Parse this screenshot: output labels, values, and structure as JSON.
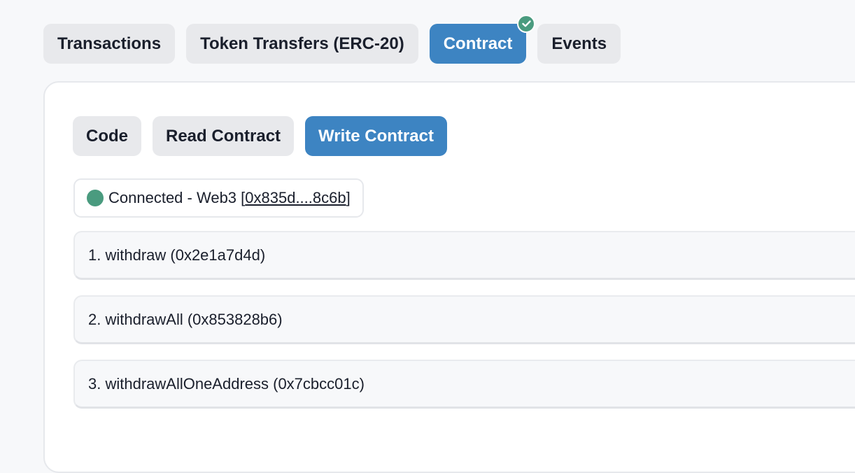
{
  "tabs": [
    {
      "label": "Transactions"
    },
    {
      "label": "Token Transfers (ERC-20)"
    },
    {
      "label": "Contract",
      "active": true
    },
    {
      "label": "Events"
    }
  ],
  "subtabs": [
    {
      "label": "Code"
    },
    {
      "label": "Read Contract"
    },
    {
      "label": "Write Contract",
      "active": true
    }
  ],
  "connection": {
    "prefix": "Connected - Web3 [",
    "address": "0x835d....8c6b",
    "suffix": "]",
    "status_color": "#4a9b7f"
  },
  "functions": [
    {
      "label": "1. withdraw (0x2e1a7d4d)"
    },
    {
      "label": "2. withdrawAll (0x853828b6)"
    },
    {
      "label": "3. withdrawAllOneAddress (0x7cbcc01c)"
    }
  ],
  "colors": {
    "accent": "#3d84c2",
    "success": "#4a9b7f"
  },
  "icons": {
    "verified": "check-icon"
  }
}
